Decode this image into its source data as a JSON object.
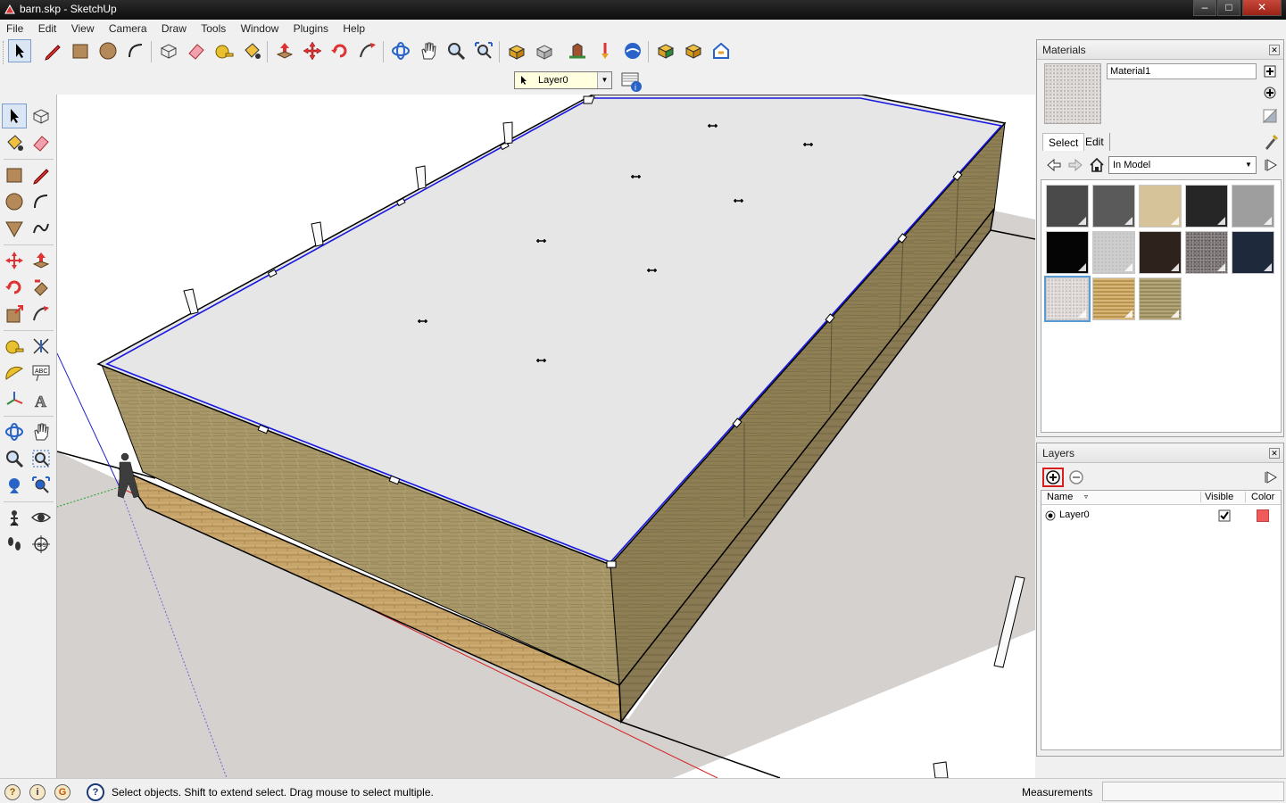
{
  "window": {
    "title": "barn.skp - SketchUp",
    "minimize": "–",
    "restore": "□",
    "close": "✕"
  },
  "menu": [
    "File",
    "Edit",
    "View",
    "Camera",
    "Draw",
    "Tools",
    "Window",
    "Plugins",
    "Help"
  ],
  "toolbar": {
    "icons": [
      "select-icon",
      "pencil-icon",
      "rectangle-icon",
      "circle-icon",
      "arc-icon",
      "make-component-icon",
      "eraser-icon",
      "tape-measure-icon",
      "paint-bucket-icon",
      "push-pull-icon",
      "move-icon",
      "rotate-icon",
      "follow-me-icon",
      "orbit-icon",
      "pan-icon",
      "zoom-icon",
      "zoom-extents-icon",
      "get-models-icon",
      "share-model-icon",
      "share-component-icon",
      "place-model-icon",
      "google-earth-icon",
      "get-photo-texture-icon",
      "preview-model-icon",
      "toggle-terrain-icon"
    ],
    "layer_value": "Layer0"
  },
  "materials": {
    "title": "Materials",
    "name_value": "Material1",
    "tabs": [
      "Select",
      "Edit"
    ],
    "collection": "In Model",
    "swatch_colors": [
      "#4a4a4a",
      "#5a5a5a",
      "#d6c39a",
      "#262626",
      "#9e9e9e",
      "#050505",
      "#cdcdcd",
      "#2e221c",
      "#7a7574",
      "#1e2a3c",
      "#dcd6d4",
      "#c9a768",
      "#a89a6a"
    ]
  },
  "layers": {
    "title": "Layers",
    "columns": {
      "name": "Name",
      "visible": "Visible",
      "color": "Color"
    },
    "rows": [
      {
        "name": "Layer0",
        "visible": true,
        "color": "#f05a5a"
      }
    ]
  },
  "status": {
    "message": "Select objects. Shift to extend select. Drag mouse to select multiple.",
    "measurements_label": "Measurements"
  }
}
